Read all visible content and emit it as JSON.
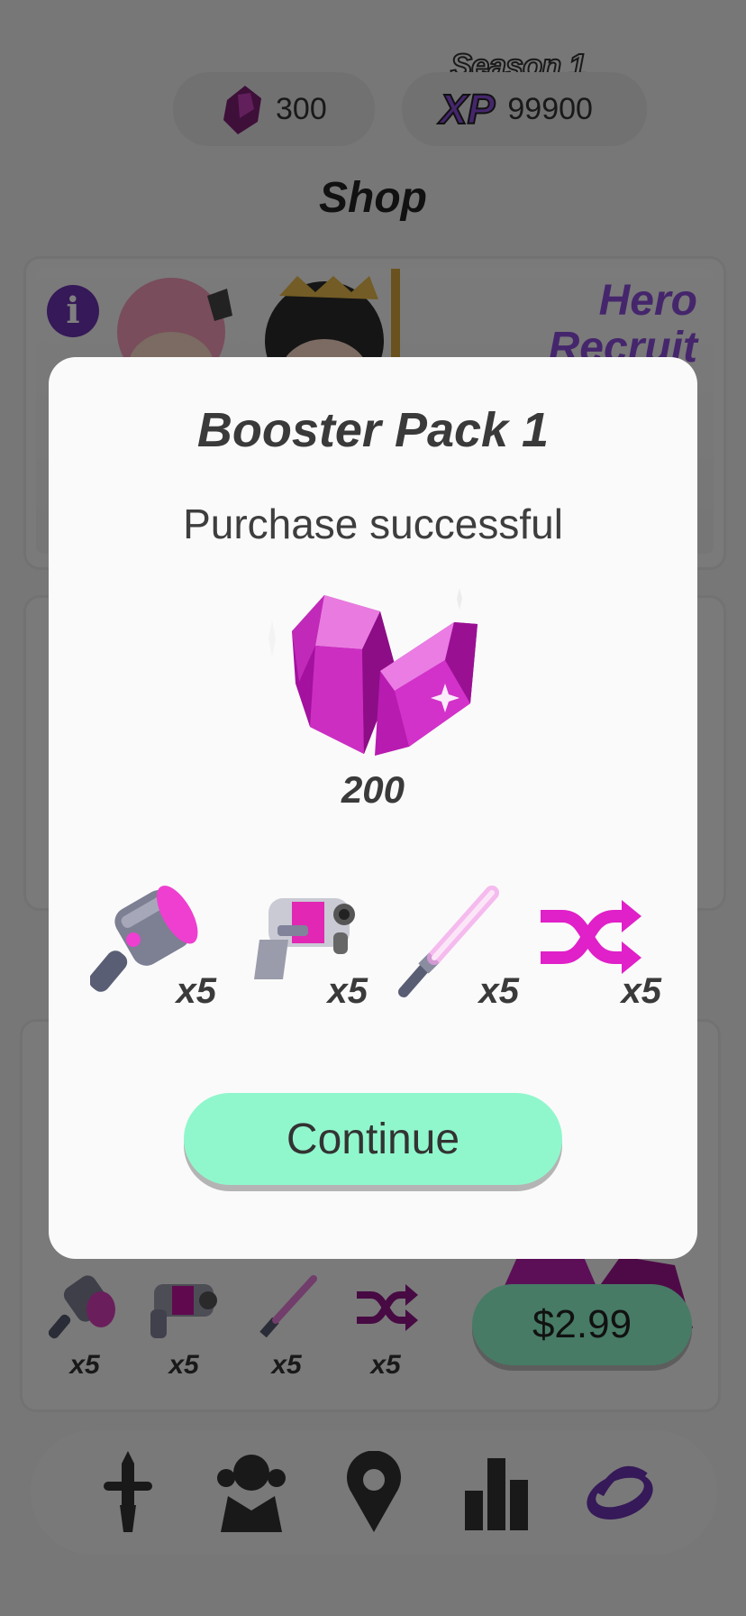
{
  "header": {
    "gem_count": "300",
    "season_label": "Season 1",
    "xp_logo": "XP",
    "xp_value": "99900"
  },
  "shop": {
    "title": "Shop",
    "hero_card": {
      "title_line1": "Hero",
      "title_line2": "Recruit",
      "info_label": "i"
    },
    "booster_items": [
      {
        "icon": "hammer-icon",
        "qty": "x5"
      },
      {
        "icon": "blaster-icon",
        "qty": "x5"
      },
      {
        "icon": "lightsaber-icon",
        "qty": "x5"
      },
      {
        "icon": "shuffle-icon",
        "qty": "x5"
      }
    ],
    "price": "$2.99"
  },
  "nav": {
    "items": [
      "sword-icon",
      "heroes-icon",
      "map-pin-icon",
      "leaderboard-icon",
      "shop-icon"
    ],
    "active": "shop-icon"
  },
  "modal": {
    "title": "Booster Pack 1",
    "subtitle": "Purchase successful",
    "gem_reward": "200",
    "items": [
      {
        "icon": "hammer-icon",
        "qty": "x5"
      },
      {
        "icon": "blaster-icon",
        "qty": "x5"
      },
      {
        "icon": "lightsaber-icon",
        "qty": "x5"
      },
      {
        "icon": "shuffle-icon",
        "qty": "x5"
      }
    ],
    "continue_label": "Continue"
  },
  "colors": {
    "accent_purple": "#8b4cd8",
    "gem_magenta": "#d41fc9",
    "button_mint": "#90f7cc"
  }
}
